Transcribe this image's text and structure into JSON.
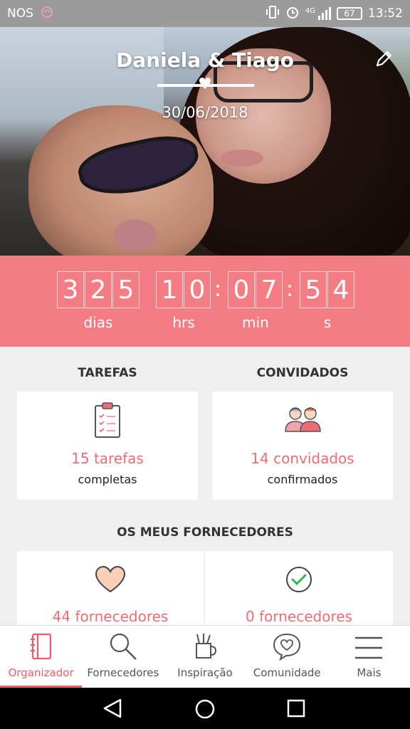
{
  "status_bar": {
    "carrier": "NOS",
    "network": "4G",
    "battery": "67",
    "time": "13:52"
  },
  "hero": {
    "names": "Daniela & Tiago",
    "date": "30/06/2018"
  },
  "countdown": {
    "days": [
      "3",
      "2",
      "5"
    ],
    "hours": [
      "1",
      "0"
    ],
    "minutes": [
      "0",
      "7"
    ],
    "seconds": [
      "5",
      "4"
    ],
    "label_days": "dias",
    "label_hours": "hrs",
    "label_minutes": "min",
    "label_seconds": "s"
  },
  "tasks": {
    "title": "TAREFAS",
    "count": "15 tarefas",
    "status": "completas"
  },
  "guests": {
    "title": "CONVIDADOS",
    "count": "14 convidados",
    "status": "confirmados"
  },
  "vendors": {
    "title": "OS MEUS FORNECEDORES",
    "favorites": "44 fornecedores",
    "hired": "0 fornecedores"
  },
  "nav": {
    "items": [
      {
        "label": "Organizador",
        "icon": "notebook-icon",
        "active": true
      },
      {
        "label": "Fornecedores",
        "icon": "search-icon",
        "active": false
      },
      {
        "label": "Inspiração",
        "icon": "pencil-cup-icon",
        "active": false
      },
      {
        "label": "Comunidade",
        "icon": "chat-heart-icon",
        "active": false
      },
      {
        "label": "Mais",
        "icon": "menu-icon",
        "active": false
      }
    ]
  },
  "colors": {
    "accent": "#f47d85",
    "accent_text": "#ee6c73",
    "status_bar": "#9b9b9b"
  }
}
